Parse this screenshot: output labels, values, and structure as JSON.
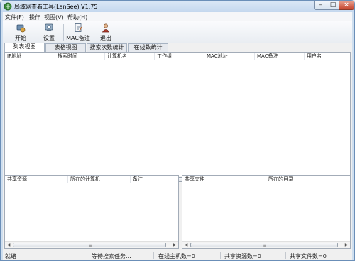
{
  "window": {
    "title": "局域网查看工具(LanSee) V1.75"
  },
  "menu": [
    {
      "label": "文件(F)"
    },
    {
      "label": "操作"
    },
    {
      "label": "视图(V)"
    },
    {
      "label": "帮助(H)"
    }
  ],
  "toolbar": [
    {
      "label": "开始",
      "icon": "start-icon"
    },
    {
      "label": "设置",
      "icon": "settings-icon"
    },
    {
      "label": "MAC备注",
      "icon": "mac-note-icon"
    },
    {
      "label": "退出",
      "icon": "exit-icon"
    }
  ],
  "tabs": [
    {
      "label": "列表视图",
      "active": true
    },
    {
      "label": "表格视图",
      "active": false
    },
    {
      "label": "搜索次数统计",
      "active": false
    },
    {
      "label": "在线数统计",
      "active": false
    }
  ],
  "main_table": {
    "columns": [
      "IP地址",
      "搜索时间",
      "计算机名",
      "工作组",
      "MAC地址",
      "MAC备注",
      "用户名"
    ],
    "rows": []
  },
  "shares_table": {
    "columns": [
      "共享资源",
      "所在的计算机",
      "备注"
    ],
    "rows": []
  },
  "files_table": {
    "columns": [
      "共享文件",
      "所在的目录"
    ],
    "rows": []
  },
  "status": {
    "ready": "就绪",
    "task": "等待搜索任务...",
    "online_hosts": "在线主机数=0",
    "share_count": "共享资源数=0",
    "file_count": "共享文件数=0"
  }
}
